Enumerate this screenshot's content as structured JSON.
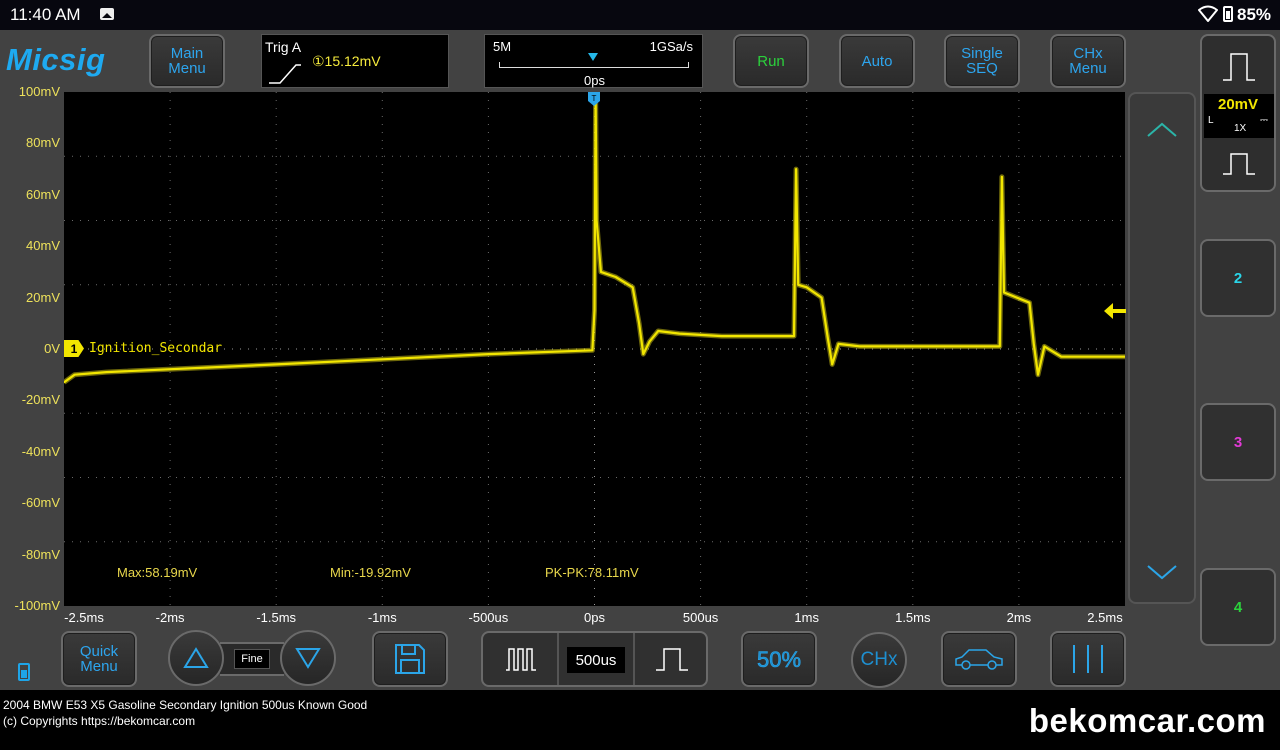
{
  "status_bar": {
    "time": "11:40 AM",
    "battery_percent": "85%",
    "icons": [
      "image-icon",
      "wifi-icon",
      "battery-icon"
    ]
  },
  "app": {
    "brand": "Micsig",
    "accent_color": "#2da5ee",
    "trace_color": "#f2e600"
  },
  "top_toolbar": {
    "main_menu": "Main Menu",
    "trigger": {
      "label": "Trig A",
      "level": "①15.12mV",
      "edge": "rising"
    },
    "timebase": {
      "memory_depth": "5M",
      "sample_rate": "1GSa/s",
      "position": "0ps"
    },
    "run": "Run",
    "auto": "Auto",
    "single_seq": "Single SEQ",
    "chx_menu": "CHx Menu"
  },
  "channel_panel": {
    "ch1_volts_div": "20mV",
    "ch1_coupling": "L",
    "ch1_probe": "1X",
    "ch1_dc_symbol": "⎓",
    "ch2": "2",
    "ch3": "3",
    "ch4": "4",
    "ch2_color": "#2ad5e8",
    "ch3_color": "#e23ad6",
    "ch4_color": "#2bd13c"
  },
  "chart_data": {
    "type": "line",
    "title": "",
    "y_tick_labels": [
      "100mV",
      "80mV",
      "60mV",
      "40mV",
      "20mV",
      "0V",
      "-20mV",
      "-40mV",
      "-60mV",
      "-80mV",
      "-100mV"
    ],
    "x_tick_labels": [
      "-2.5ms",
      "-2ms",
      "-1.5ms",
      "-1ms",
      "-500us",
      "0ps",
      "500us",
      "1ms",
      "1.5ms",
      "2ms",
      "2.5ms"
    ],
    "ylim_mV": [
      -100,
      100
    ],
    "xlim_ms": [
      -2.5,
      2.5
    ],
    "grid": true,
    "series": [
      {
        "name": "Ignition_Secondar",
        "channel": "1",
        "x_ms": [
          -2.5,
          -2.45,
          -2.3,
          -1.5,
          -1.0,
          -0.5,
          -0.01,
          0.0,
          0.005,
          0.01,
          0.03,
          0.1,
          0.18,
          0.21,
          0.23,
          0.26,
          0.3,
          0.4,
          0.6,
          0.8,
          0.94,
          0.95,
          0.96,
          1.0,
          1.07,
          1.1,
          1.12,
          1.15,
          1.25,
          1.5,
          1.7,
          1.91,
          1.92,
          1.93,
          1.96,
          2.05,
          2.07,
          2.09,
          2.12,
          2.2,
          2.5
        ],
        "y_mV": [
          -13,
          -10,
          -9,
          -6,
          -4,
          -2,
          -0.5,
          15,
          99,
          50,
          30,
          28,
          24,
          10,
          -2,
          3,
          7,
          6,
          5,
          5,
          5,
          70,
          25,
          24,
          20,
          4,
          -6,
          2,
          1,
          1,
          1,
          1,
          67,
          22,
          21,
          18,
          2,
          -10,
          1,
          -3,
          -3
        ]
      }
    ],
    "measurements": {
      "max": "Max:58.19mV",
      "min": "Min:-19.92mV",
      "pkpk": "PK-PK:78.11mV"
    },
    "trigger_level_mV": 15.12
  },
  "bottom_toolbar": {
    "quick_menu": "Quick Menu",
    "fine": "Fine",
    "time_div": "500us",
    "fifty_percent": "50%",
    "chx": "CHx"
  },
  "caption": {
    "line1": "2004 BMW E53 X5 Gasoline Secondary Ignition 500us Known Good",
    "line2": "(c) Copyrights https://bekomcar.com",
    "watermark": "bekomcar.com"
  }
}
